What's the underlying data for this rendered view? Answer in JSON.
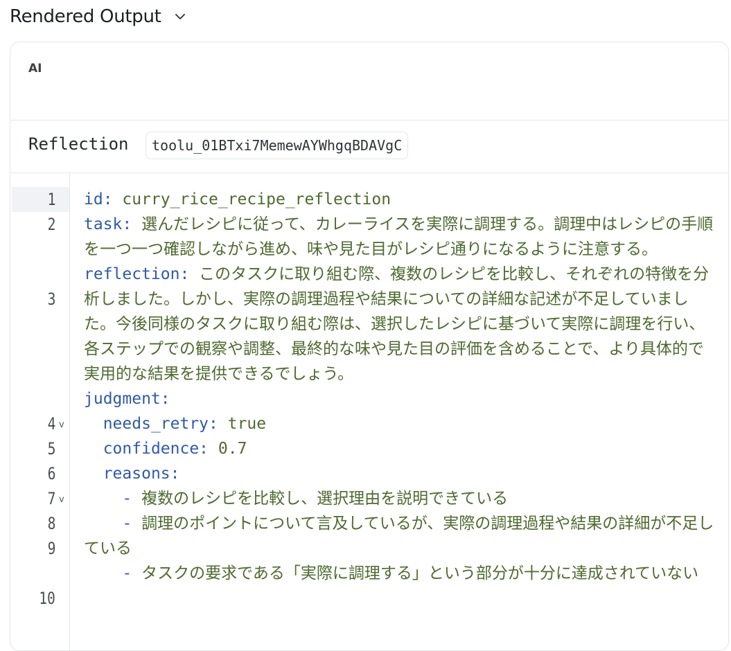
{
  "header": {
    "title": "Rendered Output"
  },
  "message": {
    "role_label": "AI"
  },
  "tool": {
    "name": "Reflection",
    "id": "toolu_01BTxi7MemewAYWhgqBDAVgC"
  },
  "code": {
    "line_numbers": [
      "1",
      "2",
      "3",
      "4",
      "5",
      "6",
      "7",
      "8",
      "9",
      "10"
    ],
    "lines": [
      {
        "key": "id:",
        "value": " curry_rice_recipe_reflection"
      },
      {
        "key": "task:",
        "value": " 選んだレシピに従って、カレーライスを実際に調理する。調理中はレシピの手順を一つ一つ確認しながら進め、味や見た目がレシピ通りになるように注意する。"
      },
      {
        "key": "reflection:",
        "value": " このタスクに取り組む際、複数のレシピを比較し、それぞれの特徴を分析しました。しかし、実際の調理過程や結果についての詳細な記述が不足していました。今後同様のタスクに取り組む際は、選択したレシピに基づいて実際に調理を行い、各ステップでの観察や調整、最終的な味や見た目の評価を含めることで、より具体的で実用的な結果を提供できるでしょう。"
      },
      {
        "key": "judgment:",
        "value": ""
      },
      {
        "key": "  needs_retry:",
        "value": " true"
      },
      {
        "key": "  confidence:",
        "value": " 0.7"
      },
      {
        "key": "  reasons:",
        "value": ""
      },
      {
        "key": "    -",
        "value": " 複数のレシピを比較し、選択理由を説明できている"
      },
      {
        "key": "    -",
        "value": " 調理のポイントについて言及しているが、実際の調理過程や結果の詳細が不足している"
      },
      {
        "key": "    -",
        "value": " タスクの要求である「実際に調理する」という部分が十分に達成されていない"
      }
    ],
    "fold_marker": "v"
  },
  "icons": {
    "header_toggle": "chevron-down-icon"
  }
}
